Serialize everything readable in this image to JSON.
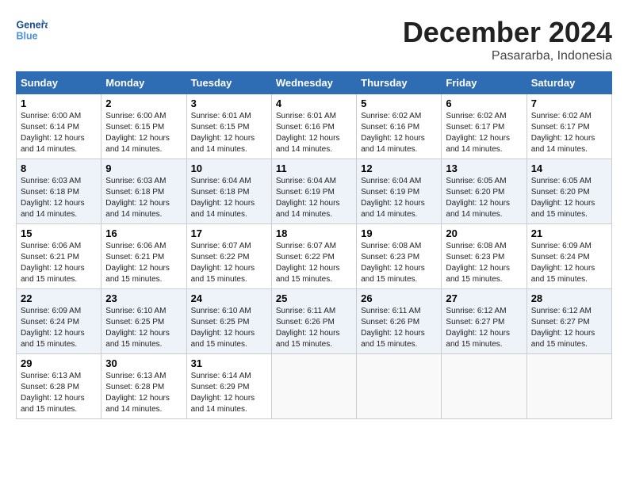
{
  "header": {
    "logo_general": "General",
    "logo_blue": "Blue",
    "month_title": "December 2024",
    "location": "Pasararba, Indonesia"
  },
  "days_of_week": [
    "Sunday",
    "Monday",
    "Tuesday",
    "Wednesday",
    "Thursday",
    "Friday",
    "Saturday"
  ],
  "weeks": [
    [
      {
        "day": 1,
        "info": "Sunrise: 6:00 AM\nSunset: 6:14 PM\nDaylight: 12 hours and 14 minutes."
      },
      {
        "day": 2,
        "info": "Sunrise: 6:00 AM\nSunset: 6:15 PM\nDaylight: 12 hours and 14 minutes."
      },
      {
        "day": 3,
        "info": "Sunrise: 6:01 AM\nSunset: 6:15 PM\nDaylight: 12 hours and 14 minutes."
      },
      {
        "day": 4,
        "info": "Sunrise: 6:01 AM\nSunset: 6:16 PM\nDaylight: 12 hours and 14 minutes."
      },
      {
        "day": 5,
        "info": "Sunrise: 6:02 AM\nSunset: 6:16 PM\nDaylight: 12 hours and 14 minutes."
      },
      {
        "day": 6,
        "info": "Sunrise: 6:02 AM\nSunset: 6:17 PM\nDaylight: 12 hours and 14 minutes."
      },
      {
        "day": 7,
        "info": "Sunrise: 6:02 AM\nSunset: 6:17 PM\nDaylight: 12 hours and 14 minutes."
      }
    ],
    [
      {
        "day": 8,
        "info": "Sunrise: 6:03 AM\nSunset: 6:18 PM\nDaylight: 12 hours and 14 minutes."
      },
      {
        "day": 9,
        "info": "Sunrise: 6:03 AM\nSunset: 6:18 PM\nDaylight: 12 hours and 14 minutes."
      },
      {
        "day": 10,
        "info": "Sunrise: 6:04 AM\nSunset: 6:18 PM\nDaylight: 12 hours and 14 minutes."
      },
      {
        "day": 11,
        "info": "Sunrise: 6:04 AM\nSunset: 6:19 PM\nDaylight: 12 hours and 14 minutes."
      },
      {
        "day": 12,
        "info": "Sunrise: 6:04 AM\nSunset: 6:19 PM\nDaylight: 12 hours and 14 minutes."
      },
      {
        "day": 13,
        "info": "Sunrise: 6:05 AM\nSunset: 6:20 PM\nDaylight: 12 hours and 14 minutes."
      },
      {
        "day": 14,
        "info": "Sunrise: 6:05 AM\nSunset: 6:20 PM\nDaylight: 12 hours and 15 minutes."
      }
    ],
    [
      {
        "day": 15,
        "info": "Sunrise: 6:06 AM\nSunset: 6:21 PM\nDaylight: 12 hours and 15 minutes."
      },
      {
        "day": 16,
        "info": "Sunrise: 6:06 AM\nSunset: 6:21 PM\nDaylight: 12 hours and 15 minutes."
      },
      {
        "day": 17,
        "info": "Sunrise: 6:07 AM\nSunset: 6:22 PM\nDaylight: 12 hours and 15 minutes."
      },
      {
        "day": 18,
        "info": "Sunrise: 6:07 AM\nSunset: 6:22 PM\nDaylight: 12 hours and 15 minutes."
      },
      {
        "day": 19,
        "info": "Sunrise: 6:08 AM\nSunset: 6:23 PM\nDaylight: 12 hours and 15 minutes."
      },
      {
        "day": 20,
        "info": "Sunrise: 6:08 AM\nSunset: 6:23 PM\nDaylight: 12 hours and 15 minutes."
      },
      {
        "day": 21,
        "info": "Sunrise: 6:09 AM\nSunset: 6:24 PM\nDaylight: 12 hours and 15 minutes."
      }
    ],
    [
      {
        "day": 22,
        "info": "Sunrise: 6:09 AM\nSunset: 6:24 PM\nDaylight: 12 hours and 15 minutes."
      },
      {
        "day": 23,
        "info": "Sunrise: 6:10 AM\nSunset: 6:25 PM\nDaylight: 12 hours and 15 minutes."
      },
      {
        "day": 24,
        "info": "Sunrise: 6:10 AM\nSunset: 6:25 PM\nDaylight: 12 hours and 15 minutes."
      },
      {
        "day": 25,
        "info": "Sunrise: 6:11 AM\nSunset: 6:26 PM\nDaylight: 12 hours and 15 minutes."
      },
      {
        "day": 26,
        "info": "Sunrise: 6:11 AM\nSunset: 6:26 PM\nDaylight: 12 hours and 15 minutes."
      },
      {
        "day": 27,
        "info": "Sunrise: 6:12 AM\nSunset: 6:27 PM\nDaylight: 12 hours and 15 minutes."
      },
      {
        "day": 28,
        "info": "Sunrise: 6:12 AM\nSunset: 6:27 PM\nDaylight: 12 hours and 15 minutes."
      }
    ],
    [
      {
        "day": 29,
        "info": "Sunrise: 6:13 AM\nSunset: 6:28 PM\nDaylight: 12 hours and 15 minutes."
      },
      {
        "day": 30,
        "info": "Sunrise: 6:13 AM\nSunset: 6:28 PM\nDaylight: 12 hours and 14 minutes."
      },
      {
        "day": 31,
        "info": "Sunrise: 6:14 AM\nSunset: 6:29 PM\nDaylight: 12 hours and 14 minutes."
      },
      null,
      null,
      null,
      null
    ]
  ]
}
